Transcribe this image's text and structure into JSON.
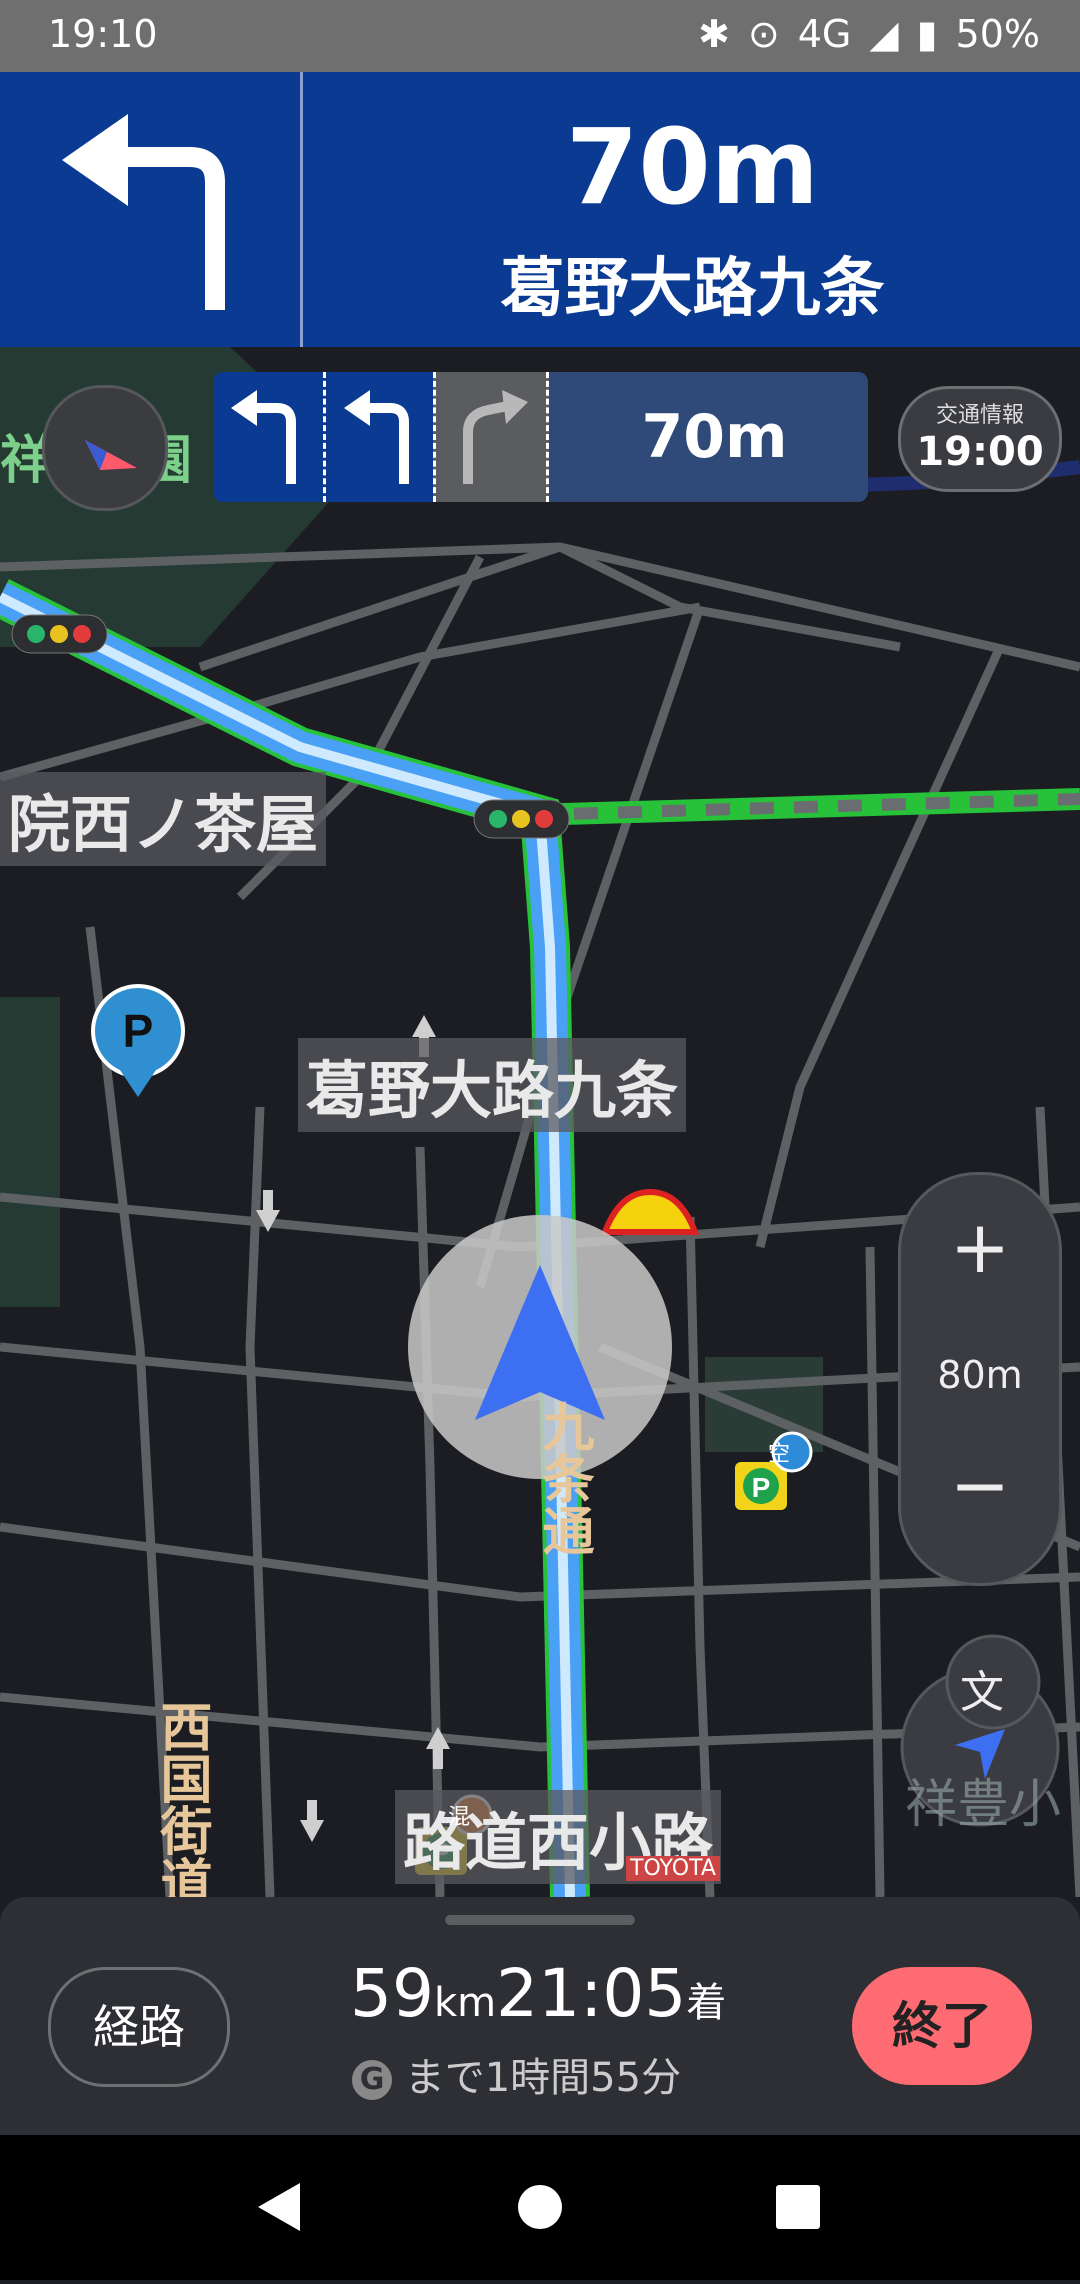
{
  "status_bar": {
    "time": "19:10",
    "network": "4G",
    "battery": "50%"
  },
  "banner": {
    "distance": "70m",
    "street": "葛野大路九条"
  },
  "lane_guidance": {
    "distance": "70m"
  },
  "traffic": {
    "label": "交通情報",
    "time": "19:00"
  },
  "map": {
    "labels": {
      "park_fragment": "祥院",
      "park_fragment2": "園",
      "west_chaya": "院西ノ茶屋",
      "kadono": "葛野大路九条",
      "kujo_dori": "九条通",
      "saikoku": "西国街道",
      "nishi_koji": "西小路",
      "right_fragment": "祥豊小",
      "mid_fragment": "路道西小路",
      "toyota": "TOYOTA"
    },
    "poi": {
      "parking": "P",
      "parking_lot_badge": "空",
      "parking_hybrid_badge": "混"
    }
  },
  "zoom": {
    "in": "+",
    "scale": "80m",
    "out": "−"
  },
  "panel": {
    "route_button": "経路",
    "distance_value": "59",
    "distance_unit": "km",
    "arrival_time": "21:05",
    "arrival_suffix": "着",
    "remaining": "まで1時間55分"
  },
  "colors": {
    "banner": "#0b3a93",
    "route": "#7fc3ff",
    "end_button": "#ff6b72",
    "green_road": "#27c23a"
  }
}
